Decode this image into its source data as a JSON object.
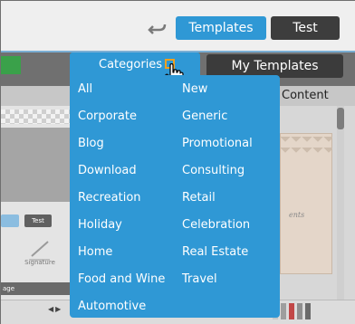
{
  "toolbar": {
    "undo_icon": "undo-arrow-icon",
    "templates_label": "Templates",
    "test_label": "Test"
  },
  "tabs": {
    "categories_label": "Categories",
    "my_templates_label": "My Templates",
    "content_label": "Content"
  },
  "left_panel": {
    "mini_test_label": "Test",
    "signature_label": "Signature",
    "bottom_label": "age"
  },
  "categories": {
    "left_column": [
      "All",
      "Corporate",
      "Blog",
      "Download",
      "Recreation",
      "Holiday",
      "Home",
      "Food and Wine",
      "Automotive"
    ],
    "right_column": [
      "New",
      "Generic",
      "Promotional",
      "Consulting",
      "Retail",
      "Celebration",
      "Real Estate",
      "Travel"
    ]
  },
  "preview": {
    "text": "ents"
  },
  "colors": {
    "accent": "#2f98d5",
    "dark_button": "#3d3d3d",
    "dropdown_highlight": "#f0a020"
  }
}
